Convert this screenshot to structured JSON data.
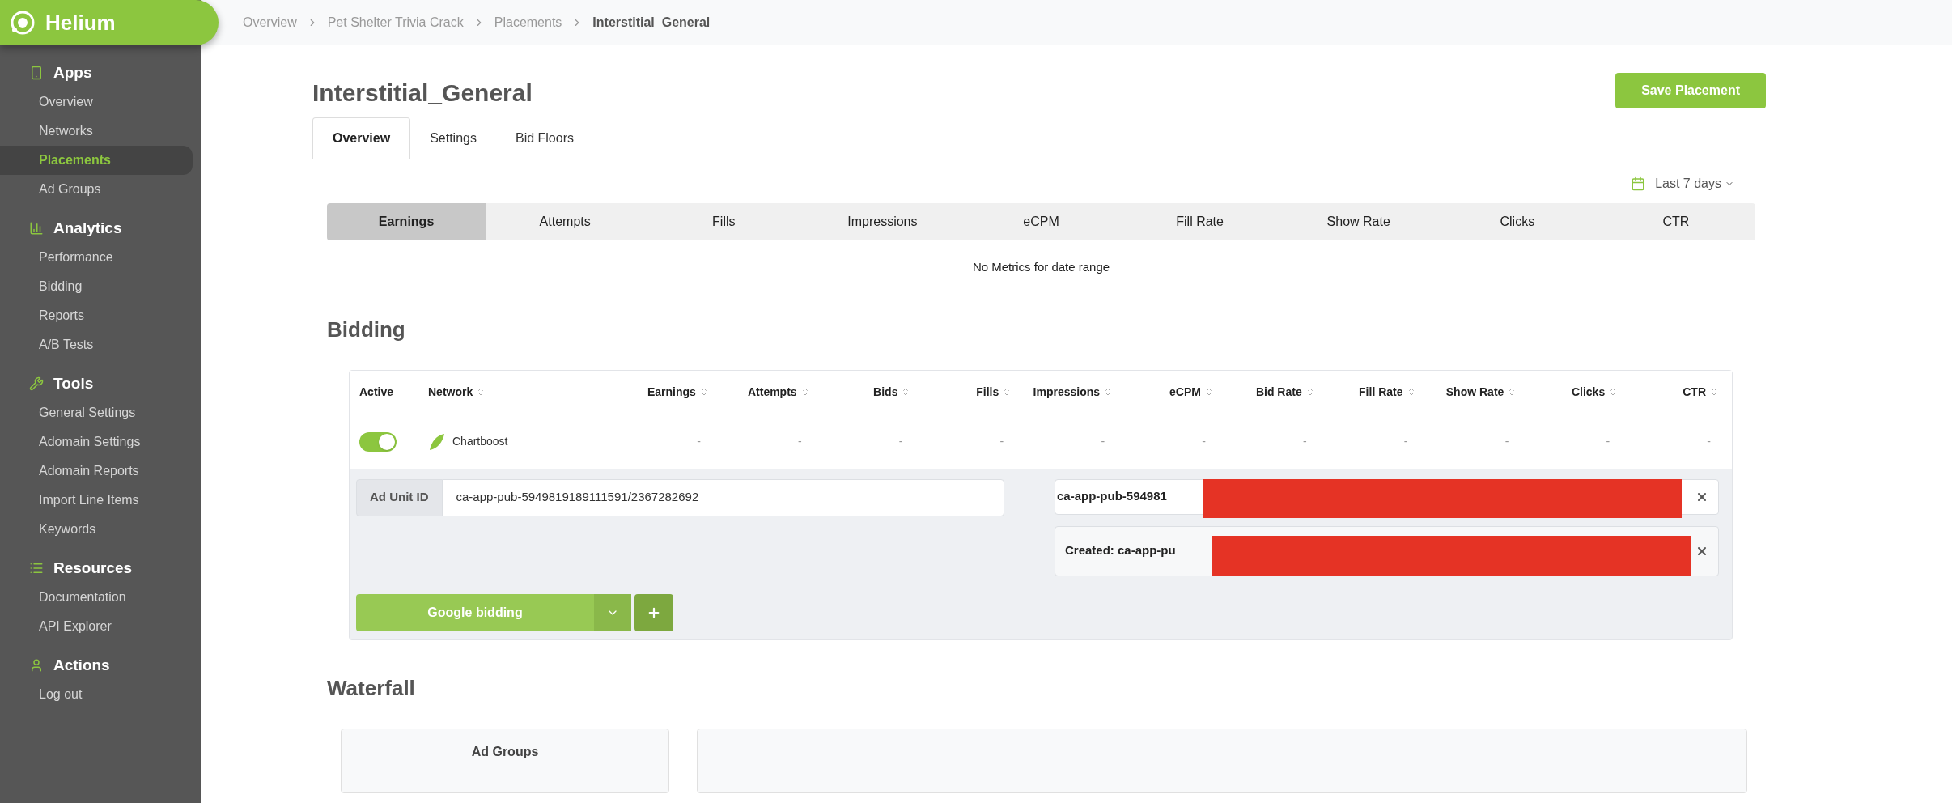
{
  "logo": {
    "name": "Helium"
  },
  "breadcrumbs": [
    {
      "label": "Overview",
      "current": false
    },
    {
      "label": "Pet Shelter Trivia Crack",
      "current": false
    },
    {
      "label": "Placements",
      "current": false
    },
    {
      "label": "Interstitial_General",
      "current": true
    }
  ],
  "sidebar": [
    {
      "title": "Apps",
      "items": [
        {
          "label": "Overview",
          "selected": false
        },
        {
          "label": "Networks",
          "selected": false
        },
        {
          "label": "Placements",
          "selected": true
        },
        {
          "label": "Ad Groups",
          "selected": false
        }
      ]
    },
    {
      "title": "Analytics",
      "items": [
        {
          "label": "Performance",
          "selected": false
        },
        {
          "label": "Bidding",
          "selected": false
        },
        {
          "label": "Reports",
          "selected": false
        },
        {
          "label": "A/B Tests",
          "selected": false
        }
      ]
    },
    {
      "title": "Tools",
      "items": [
        {
          "label": "General Settings",
          "selected": false
        },
        {
          "label": "Adomain Settings",
          "selected": false
        },
        {
          "label": "Adomain Reports",
          "selected": false
        },
        {
          "label": "Import Line Items",
          "selected": false
        },
        {
          "label": "Keywords",
          "selected": false
        }
      ]
    },
    {
      "title": "Resources",
      "items": [
        {
          "label": "Documentation",
          "selected": false
        },
        {
          "label": "API Explorer",
          "selected": false
        }
      ]
    },
    {
      "title": "Actions",
      "items": [
        {
          "label": "Log out",
          "selected": false
        }
      ]
    }
  ],
  "page_title": "Interstitial_General",
  "save_button": "Save Placement",
  "tabs": [
    {
      "label": "Overview",
      "selected": true
    },
    {
      "label": "Settings",
      "selected": false
    },
    {
      "label": "Bid Floors",
      "selected": false
    }
  ],
  "date_range": "Last 7 days",
  "metric_tabs": [
    {
      "label": "Earnings",
      "selected": true
    },
    {
      "label": "Attempts",
      "selected": false
    },
    {
      "label": "Fills",
      "selected": false
    },
    {
      "label": "Impressions",
      "selected": false
    },
    {
      "label": "eCPM",
      "selected": false
    },
    {
      "label": "Fill Rate",
      "selected": false
    },
    {
      "label": "Show Rate",
      "selected": false
    },
    {
      "label": "Clicks",
      "selected": false
    },
    {
      "label": "CTR",
      "selected": false
    }
  ],
  "metrics_message": "No Metrics for date range",
  "bidding": {
    "title": "Bidding",
    "columns": [
      {
        "label": "Active",
        "sortable": false
      },
      {
        "label": "Network",
        "sortable": true
      },
      {
        "label": "Earnings",
        "sortable": true
      },
      {
        "label": "Attempts",
        "sortable": true
      },
      {
        "label": "Bids",
        "sortable": true
      },
      {
        "label": "Fills",
        "sortable": true
      },
      {
        "label": "Impressions",
        "sortable": true
      },
      {
        "label": "eCPM",
        "sortable": true
      },
      {
        "label": "Bid Rate",
        "sortable": true
      },
      {
        "label": "Fill Rate",
        "sortable": true
      },
      {
        "label": "Show Rate",
        "sortable": true
      },
      {
        "label": "Clicks",
        "sortable": true
      },
      {
        "label": "CTR",
        "sortable": true
      }
    ],
    "rows": [
      {
        "cells": [
          {
            "kind": "toggle",
            "on": true
          },
          {
            "kind": "network",
            "text": "Chartboost"
          },
          {
            "kind": "text",
            "text": "-"
          },
          {
            "kind": "text",
            "text": "-"
          },
          {
            "kind": "text",
            "text": "-"
          },
          {
            "kind": "text",
            "text": "-"
          },
          {
            "kind": "text",
            "text": "-"
          },
          {
            "kind": "text",
            "text": "-"
          },
          {
            "kind": "text",
            "text": "-"
          },
          {
            "kind": "text",
            "text": "-"
          },
          {
            "kind": "text",
            "text": "-"
          },
          {
            "kind": "text",
            "text": "-"
          },
          {
            "kind": "text",
            "text": "-"
          }
        ]
      }
    ],
    "ad_unit": {
      "label": "Ad Unit ID",
      "value": "ca-app-pub-5949819189111591/2367282692"
    },
    "tags": [
      {
        "text": "ca-app-pub-594981",
        "kind": "input"
      },
      {
        "text": "Created: ca-app-pu",
        "kind": "message"
      }
    ],
    "network_select": "Google bidding"
  },
  "waterfall": {
    "title": "Waterfall",
    "ad_groups_header": "Ad Groups"
  }
}
